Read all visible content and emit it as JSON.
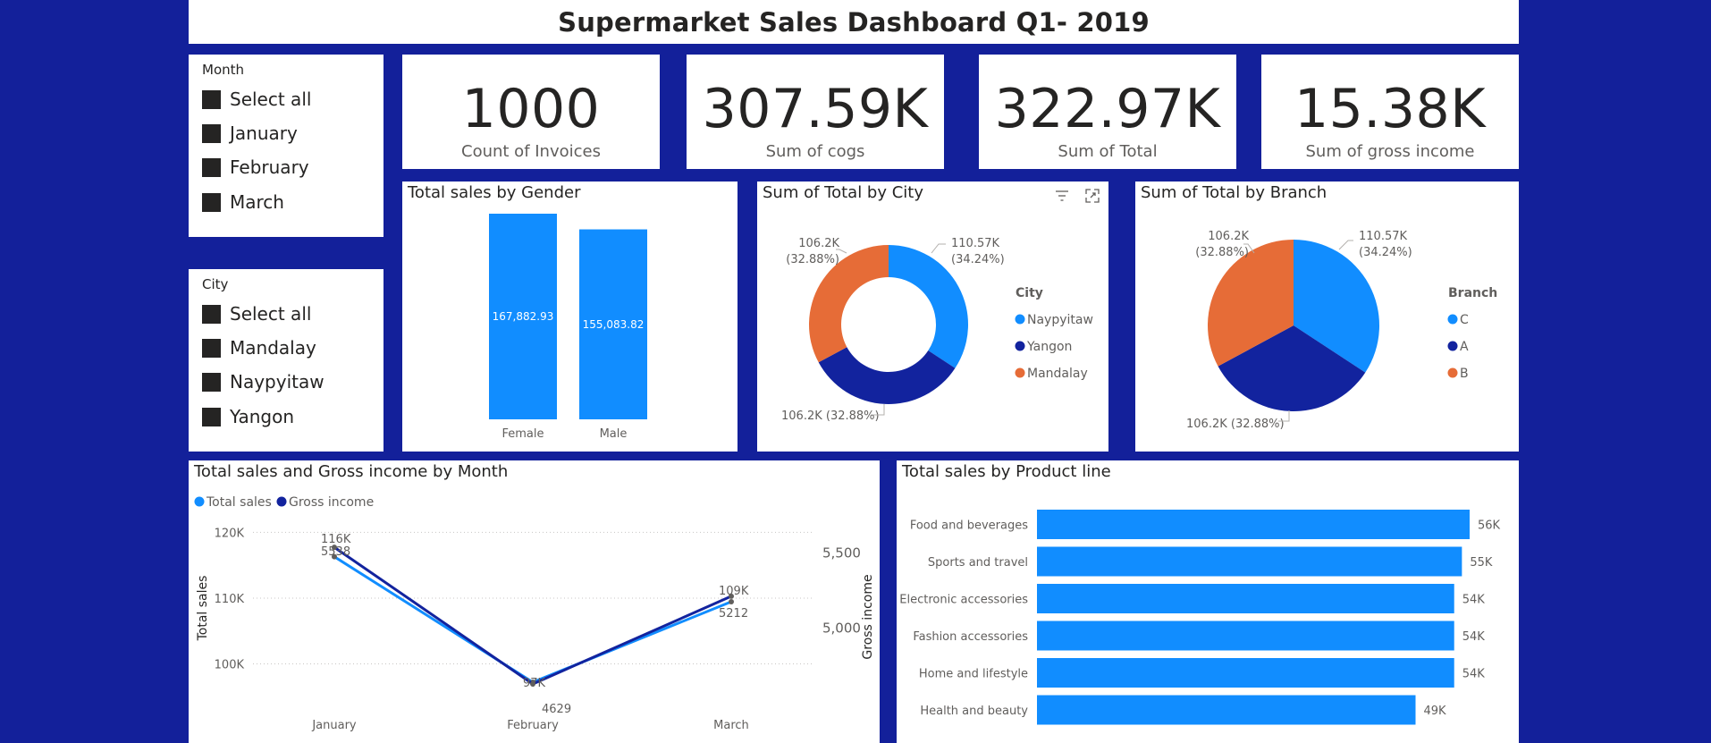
{
  "header": {
    "title": "Supermarket Sales Dashboard Q1- 2019"
  },
  "colors": {
    "background": "#13209a",
    "accent_blue": "#118dff",
    "dark_blue": "#12239e",
    "orange": "#e66c37"
  },
  "month_slicer": {
    "title": "Month",
    "items": [
      "Select all",
      "January",
      "February",
      "March"
    ]
  },
  "city_slicer": {
    "title": "City",
    "items": [
      "Select all",
      "Mandalay",
      "Naypyitaw",
      "Yangon"
    ]
  },
  "cards": [
    {
      "value": "1000",
      "label": "Count of Invoices"
    },
    {
      "value": "307.59K",
      "label": "Sum of cogs"
    },
    {
      "value": "322.97K",
      "label": "Sum of Total"
    },
    {
      "value": "15.38K",
      "label": "Sum of gross income"
    }
  ],
  "chart_data": [
    {
      "type": "bar",
      "title": "Total sales by Gender",
      "categories": [
        "Female",
        "Male"
      ],
      "values": [
        167882.93,
        155083.82
      ],
      "data_labels": [
        "167,882.93",
        "155,083.82"
      ]
    },
    {
      "type": "pie",
      "variant": "donut",
      "title": "Sum of Total by City",
      "legend_title": "City",
      "legend_position": "right",
      "slices": [
        {
          "name": "Naypyitaw",
          "value": 110.57,
          "label": "110.57K",
          "pct": "(34.24%)",
          "color": "#118dff"
        },
        {
          "name": "Yangon",
          "value": 106.2,
          "label": "106.2K (32.88%)",
          "pct": "",
          "color": "#12239e"
        },
        {
          "name": "Mandalay",
          "value": 106.2,
          "label": "106.2K",
          "pct": "(32.88%)",
          "color": "#e66c37"
        }
      ]
    },
    {
      "type": "pie",
      "title": "Sum of Total by Branch",
      "legend_title": "Branch",
      "legend_position": "right",
      "slices": [
        {
          "name": "C",
          "value": 110.57,
          "label": "110.57K",
          "pct": "(34.24%)",
          "color": "#118dff"
        },
        {
          "name": "A",
          "value": 106.2,
          "label": "106.2K (32.88%)",
          "pct": "",
          "color": "#12239e"
        },
        {
          "name": "B",
          "value": 106.2,
          "label": "106.2K",
          "pct": "(32.88%)",
          "color": "#e66c37"
        }
      ]
    },
    {
      "type": "line",
      "title": "Total sales and Gross income by Month",
      "categories": [
        "January",
        "February",
        "March"
      ],
      "ylabel": "Total sales",
      "y2label": "Gross income",
      "ylim": [
        96000,
        121000
      ],
      "y2lim": [
        4588,
        5681
      ],
      "y_ticks": [
        {
          "value": 100000,
          "label": "100K"
        },
        {
          "value": 110000,
          "label": "110K"
        },
        {
          "value": 120000,
          "label": "120K"
        }
      ],
      "y2_ticks": [
        {
          "value": 5000,
          "label": "5,000"
        },
        {
          "value": 5500,
          "label": "5,500"
        }
      ],
      "legend_position": "top-left",
      "series": [
        {
          "name": "Total sales",
          "axis": "left",
          "color": "#118dff",
          "values": [
            116291.87,
            97219.37,
            109455.51
          ],
          "labels": [
            "",
            "97K",
            "109K"
          ]
        },
        {
          "name": "Gross income",
          "axis": "right",
          "color": "#12239e",
          "values": [
            5537.7,
            4629.5,
            5212.2
          ],
          "labels": [
            "5538",
            "4629",
            "5212"
          ]
        }
      ],
      "extra_labels": [
        "116K"
      ],
      "grid": true
    },
    {
      "type": "bar",
      "orientation": "horizontal",
      "title": "Total sales by Product line",
      "categories": [
        "Food and beverages",
        "Sports and travel",
        "Electronic accessories",
        "Fashion accessories",
        "Home and lifestyle",
        "Health and beauty"
      ],
      "values": [
        56000,
        55000,
        54000,
        54000,
        54000,
        49000
      ],
      "data_labels": [
        "56K",
        "55K",
        "54K",
        "54K",
        "54K",
        "49K"
      ]
    }
  ]
}
